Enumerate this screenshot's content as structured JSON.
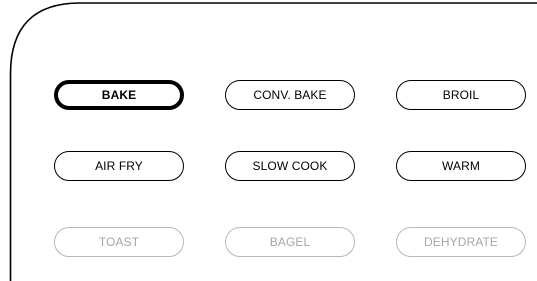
{
  "colors": {
    "active_border": "#000000",
    "active_text": "#000000",
    "disabled_border": "#b8b8b8",
    "disabled_text": "#a6a6a6",
    "background": "#ffffff"
  },
  "cooking_modes": {
    "selected": "BAKE",
    "row1": {
      "bake": "BAKE",
      "conv_bake": "CONV. BAKE",
      "broil": "BROIL"
    },
    "row2": {
      "air_fry": "AIR FRY",
      "slow_cook": "SLOW COOK",
      "warm": "WARM"
    },
    "row3_disabled": {
      "toast": "TOAST",
      "bagel": "BAGEL",
      "dehydrate": "DEHYDRATE"
    }
  }
}
